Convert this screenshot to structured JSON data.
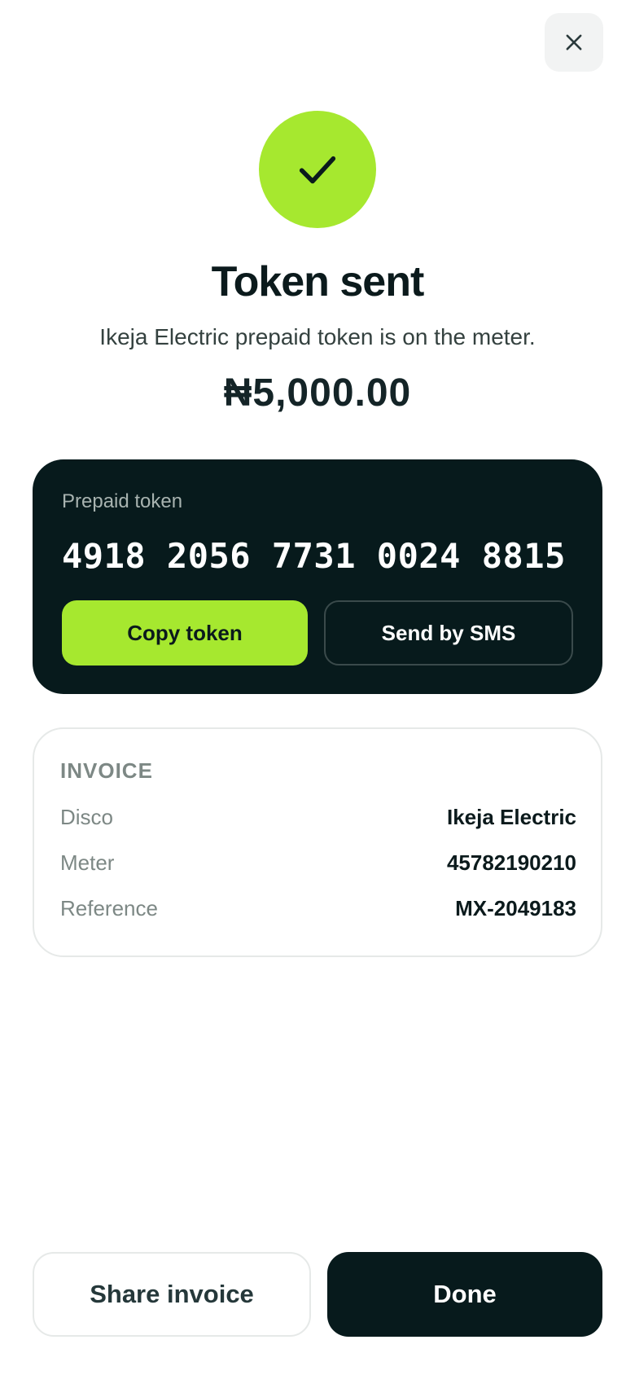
{
  "icons": {
    "close": "close-icon",
    "success": "checkmark-icon"
  },
  "colors": {
    "accent": "#a6e82f",
    "dark": "#071a1c",
    "muted": "#7d8885"
  },
  "header": {
    "title": "Token sent",
    "subtitle": "Ikeja Electric prepaid token is on the meter.",
    "amount": "₦5,000.00"
  },
  "token_card": {
    "label": "Prepaid token",
    "token": "4918 2056 7731 0024 8815",
    "copy_label": "Copy token",
    "sms_label": "Send by SMS"
  },
  "invoice": {
    "heading": "INVOICE",
    "rows": [
      {
        "key": "Disco",
        "value": "Ikeja Electric"
      },
      {
        "key": "Meter",
        "value": "45782190210"
      },
      {
        "key": "Reference",
        "value": "MX-2049183"
      }
    ]
  },
  "footer": {
    "share_label": "Share invoice",
    "done_label": "Done"
  }
}
